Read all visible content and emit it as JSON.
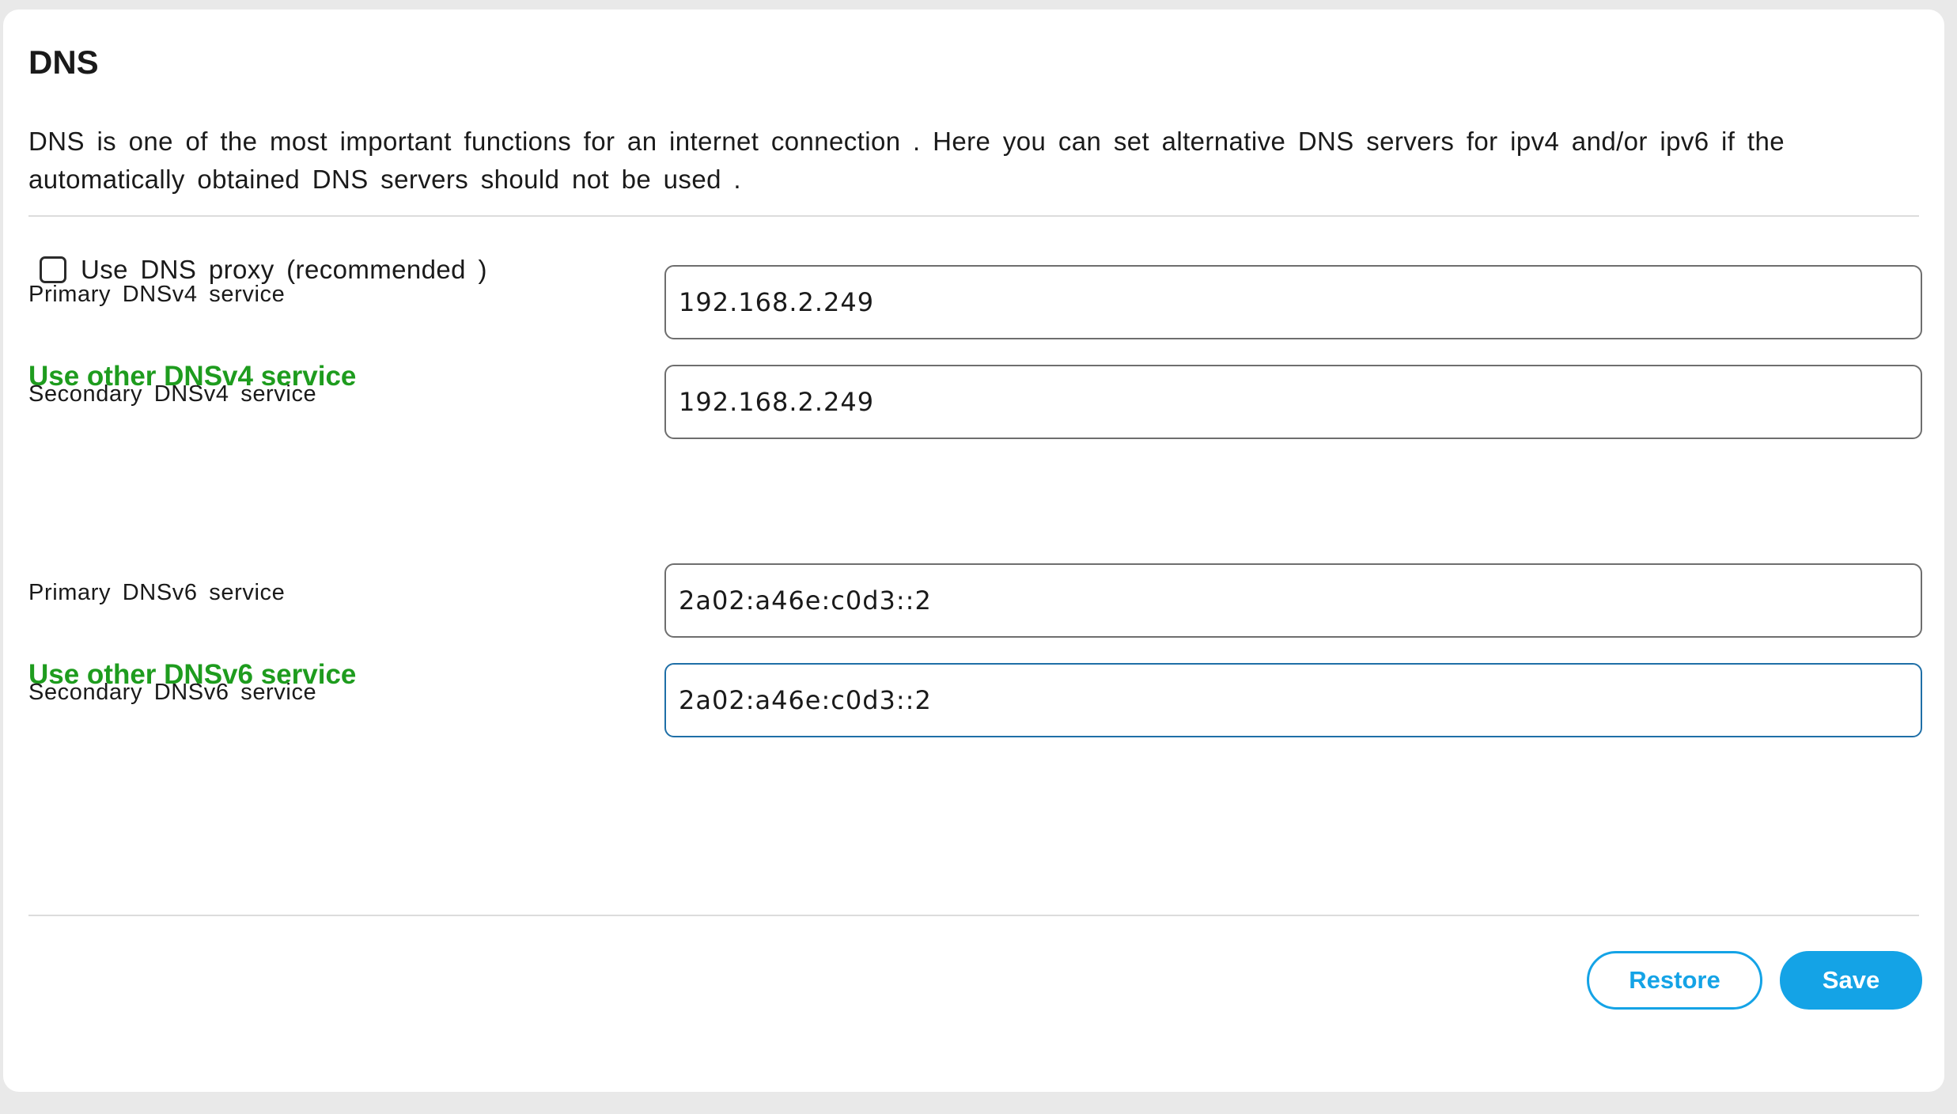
{
  "page": {
    "title": "DNS",
    "description": "DNS is one of the most important functions for an internet connection . Here you can set alternative DNS servers for ipv4 and/or ipv6 if the automatically obtained DNS servers should not be used ."
  },
  "dns_proxy": {
    "label": "Use DNS proxy (recommended )",
    "checked": false
  },
  "dnsv4": {
    "heading": "Use other DNSv4 service",
    "primary_label": "Primary DNSv4 service",
    "primary_value": "192.168.2.249",
    "secondary_label": "Secondary DNSv4 service",
    "secondary_value": "192.168.2.249"
  },
  "dnsv6": {
    "heading": "Use other DNSv6 service",
    "primary_label": "Primary DNSv6 service",
    "primary_value": "2a02:a46e:c0d3::2",
    "secondary_label": "Secondary DNSv6 service",
    "secondary_value": "2a02:a46e:c0d3::2"
  },
  "actions": {
    "restore_label": "Restore",
    "save_label": "Save"
  },
  "colors": {
    "section_heading": "#1e9c1e",
    "button_accent": "#14a3e6",
    "focus_border": "#1f6fa7"
  }
}
